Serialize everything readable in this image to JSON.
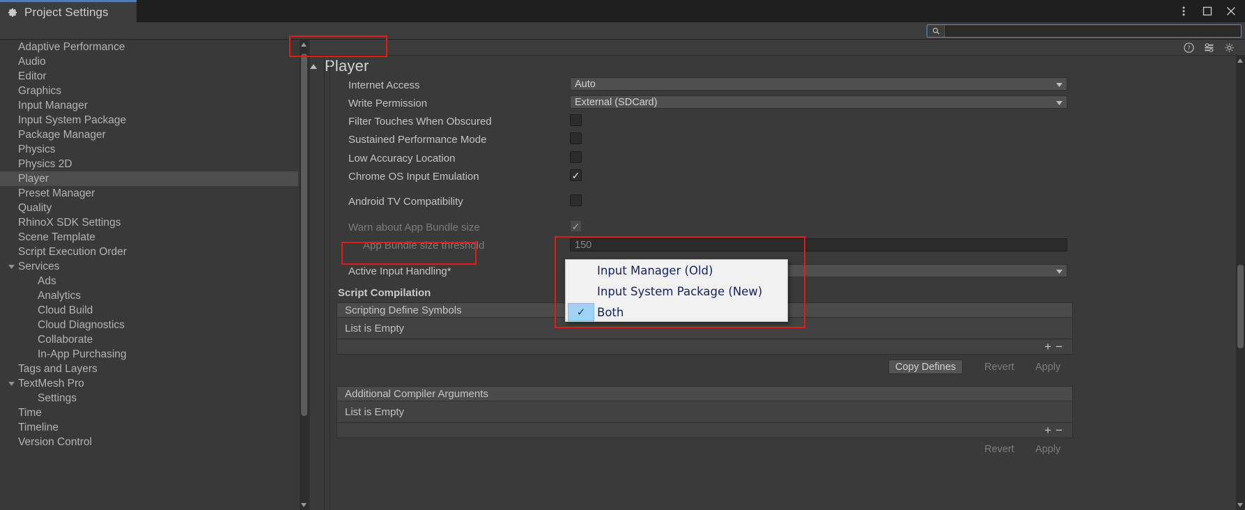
{
  "window": {
    "tab_title": "Project Settings",
    "tab_icon": "gear-icon",
    "menu_icon": "kebab-menu-icon",
    "maximize_icon": "maximize-icon",
    "close_icon": "close-icon"
  },
  "search": {
    "icon": "search-icon",
    "value": "",
    "placeholder": ""
  },
  "sidebar": {
    "items": [
      {
        "label": "Adaptive Performance",
        "depth": 0,
        "expandable": false,
        "selected": false
      },
      {
        "label": "Audio",
        "depth": 0,
        "expandable": false,
        "selected": false
      },
      {
        "label": "Editor",
        "depth": 0,
        "expandable": false,
        "selected": false
      },
      {
        "label": "Graphics",
        "depth": 0,
        "expandable": false,
        "selected": false
      },
      {
        "label": "Input Manager",
        "depth": 0,
        "expandable": false,
        "selected": false
      },
      {
        "label": "Input System Package",
        "depth": 0,
        "expandable": false,
        "selected": false
      },
      {
        "label": "Package Manager",
        "depth": 0,
        "expandable": false,
        "selected": false
      },
      {
        "label": "Physics",
        "depth": 0,
        "expandable": false,
        "selected": false
      },
      {
        "label": "Physics 2D",
        "depth": 0,
        "expandable": false,
        "selected": false
      },
      {
        "label": "Player",
        "depth": 0,
        "expandable": false,
        "selected": true
      },
      {
        "label": "Preset Manager",
        "depth": 0,
        "expandable": false,
        "selected": false
      },
      {
        "label": "Quality",
        "depth": 0,
        "expandable": false,
        "selected": false
      },
      {
        "label": "RhinoX SDK Settings",
        "depth": 0,
        "expandable": false,
        "selected": false
      },
      {
        "label": "Scene Template",
        "depth": 0,
        "expandable": false,
        "selected": false
      },
      {
        "label": "Script Execution Order",
        "depth": 0,
        "expandable": false,
        "selected": false
      },
      {
        "label": "Services",
        "depth": 0,
        "expandable": true,
        "selected": false
      },
      {
        "label": "Ads",
        "depth": 1,
        "expandable": false,
        "selected": false
      },
      {
        "label": "Analytics",
        "depth": 1,
        "expandable": false,
        "selected": false
      },
      {
        "label": "Cloud Build",
        "depth": 1,
        "expandable": false,
        "selected": false
      },
      {
        "label": "Cloud Diagnostics",
        "depth": 1,
        "expandable": false,
        "selected": false
      },
      {
        "label": "Collaborate",
        "depth": 1,
        "expandable": false,
        "selected": false
      },
      {
        "label": "In-App Purchasing",
        "depth": 1,
        "expandable": false,
        "selected": false
      },
      {
        "label": "Tags and Layers",
        "depth": 0,
        "expandable": false,
        "selected": false
      },
      {
        "label": "TextMesh Pro",
        "depth": 0,
        "expandable": true,
        "selected": false
      },
      {
        "label": "Settings",
        "depth": 1,
        "expandable": false,
        "selected": false
      },
      {
        "label": "Time",
        "depth": 0,
        "expandable": false,
        "selected": false
      },
      {
        "label": "Timeline",
        "depth": 0,
        "expandable": false,
        "selected": false
      },
      {
        "label": "Version Control",
        "depth": 0,
        "expandable": false,
        "selected": false
      }
    ]
  },
  "main": {
    "page_title": "Player",
    "header_icons": {
      "help": "help-icon",
      "preset": "preset-icon",
      "settings": "gear-icon"
    },
    "rows": [
      {
        "label": "Internet Access",
        "type": "popup",
        "value": "Auto",
        "dim": false,
        "indent": false
      },
      {
        "label": "Write Permission",
        "type": "popup",
        "value": "External (SDCard)",
        "dim": false,
        "indent": false
      },
      {
        "label": "Filter Touches When Obscured",
        "type": "checkbox",
        "checked": false,
        "dim": false,
        "indent": false
      },
      {
        "label": "Sustained Performance Mode",
        "type": "checkbox",
        "checked": false,
        "dim": false,
        "indent": false
      },
      {
        "label": "Low Accuracy Location",
        "type": "checkbox",
        "checked": false,
        "dim": false,
        "indent": false
      },
      {
        "label": "Chrome OS Input Emulation",
        "type": "checkbox",
        "checked": true,
        "dim": false,
        "indent": false
      },
      {
        "label": "Android TV Compatibility",
        "type": "checkbox",
        "checked": false,
        "dim": false,
        "indent": false
      },
      {
        "label": "Warn about App Bundle size",
        "type": "checkbox",
        "checked": true,
        "dim": true,
        "indent": false
      },
      {
        "label": "App Bundle size threshold",
        "type": "text",
        "value": "150",
        "dim": true,
        "indent": true
      },
      {
        "label": "Active Input Handling*",
        "type": "popup",
        "value": "Both",
        "dim": false,
        "indent": false
      }
    ],
    "section_script_compilation": "Script Compilation",
    "scripting_define": {
      "header": "Scripting Define Symbols",
      "empty_text": "List is Empty",
      "add_icon": "plus-icon",
      "remove_icon": "minus-icon"
    },
    "define_buttons": {
      "copy": "Copy Defines",
      "revert": "Revert",
      "apply": "Apply"
    },
    "additional_args": {
      "header": "Additional Compiler Arguments",
      "empty_text": "List is Empty",
      "add_icon": "plus-icon",
      "remove_icon": "minus-icon"
    },
    "args_buttons": {
      "revert": "Revert",
      "apply": "Apply"
    }
  },
  "dropdown": {
    "open": true,
    "options": [
      {
        "label": "Input Manager (Old)",
        "checked": false
      },
      {
        "label": "Input System Package (New)",
        "checked": false
      },
      {
        "label": "Both",
        "checked": true
      }
    ]
  },
  "annotations": {
    "color": "#e31b1b",
    "boxes": [
      "player-title",
      "active-input-handling-label",
      "active-input-handling-dropdown"
    ]
  }
}
